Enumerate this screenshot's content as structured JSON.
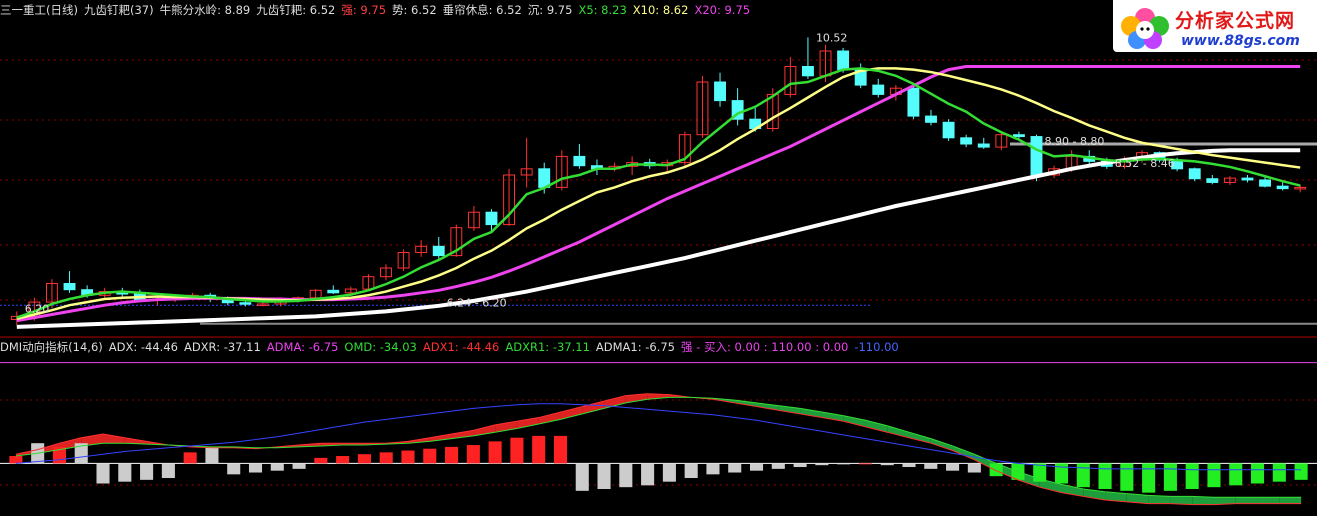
{
  "header_top": [
    {
      "text": "三一重工(日线)",
      "color": "#dddddd"
    },
    {
      "text": "九齿钉耙(37)",
      "color": "#dddddd"
    },
    {
      "text": "牛熊分水岭: 8.89",
      "color": "#dddddd"
    },
    {
      "text": "九齿钉耙: 6.52",
      "color": "#dddddd"
    },
    {
      "text": "强: 9.75",
      "color": "#ff4040"
    },
    {
      "text": "势: 6.52",
      "color": "#dddddd"
    },
    {
      "text": "垂帘休息: 6.52",
      "color": "#dddddd"
    },
    {
      "text": "沉: 9.75",
      "color": "#dddddd"
    },
    {
      "text": "X5: 8.23",
      "color": "#33dd33"
    },
    {
      "text": "X10: 8.62",
      "color": "#ffff88"
    },
    {
      "text": "X20: 9.75",
      "color": "#ee44ee"
    }
  ],
  "header_bottom": [
    {
      "text": "DMI动向指标(14,6)",
      "color": "#dddddd"
    },
    {
      "text": "ADX: -44.46",
      "color": "#dddddd"
    },
    {
      "text": "ADXR: -37.11",
      "color": "#dddddd"
    },
    {
      "text": "ADMA: -6.75",
      "color": "#ee44ee"
    },
    {
      "text": "OMD: -34.03",
      "color": "#33dd33"
    },
    {
      "text": "ADX1: -44.46",
      "color": "#ff3030"
    },
    {
      "text": "ADXR1: -37.11",
      "color": "#33dd33"
    },
    {
      "text": "ADMA1: -6.75",
      "color": "#dddddd"
    },
    {
      "text": "强 - 买入: 0.00 : 110.00 : 0.00",
      "color": "#ee44ee"
    },
    {
      "text": "-110.00",
      "color": "#4466ff"
    }
  ],
  "logo": {
    "text": "分析家公式网",
    "url": "www.88gs.com"
  },
  "colors": {
    "up": "#ff3333",
    "down": "#54fcfc",
    "x5": "#33dd33",
    "x10": "#ffff88",
    "x20": "#ee44ee",
    "long_ma": "#ffffff",
    "adx_line": "#3344ff",
    "grid": "#8b0000"
  },
  "chart_data": [
    {
      "type": "candlestick",
      "annotations": [
        "10.52",
        "8.90 - 8.80",
        "6.24 - 6.20",
        "6.20",
        "8.52 - 8.46"
      ],
      "ohlc": [
        [
          5.97,
          6.1,
          5.88,
          6.02
        ],
        [
          6.02,
          6.32,
          5.95,
          6.25
        ],
        [
          6.25,
          6.62,
          6.15,
          6.55
        ],
        [
          6.55,
          6.75,
          6.4,
          6.45
        ],
        [
          6.45,
          6.52,
          6.32,
          6.36
        ],
        [
          6.36,
          6.48,
          6.3,
          6.42
        ],
        [
          6.42,
          6.48,
          6.33,
          6.38
        ],
        [
          6.38,
          6.45,
          6.25,
          6.28
        ],
        [
          6.28,
          6.35,
          6.2,
          6.3
        ],
        [
          6.3,
          6.38,
          6.25,
          6.34
        ],
        [
          6.34,
          6.4,
          6.28,
          6.36
        ],
        [
          6.36,
          6.4,
          6.25,
          6.3
        ],
        [
          6.3,
          6.34,
          6.2,
          6.24
        ],
        [
          6.24,
          6.28,
          6.18,
          6.22
        ],
        [
          6.22,
          6.26,
          6.18,
          6.22
        ],
        [
          6.22,
          6.3,
          6.18,
          6.27
        ],
        [
          6.27,
          6.34,
          6.24,
          6.32
        ],
        [
          6.32,
          6.46,
          6.3,
          6.44
        ],
        [
          6.44,
          6.52,
          6.38,
          6.4
        ],
        [
          6.4,
          6.5,
          6.36,
          6.46
        ],
        [
          6.46,
          6.7,
          6.44,
          6.66
        ],
        [
          6.66,
          6.86,
          6.6,
          6.8
        ],
        [
          6.8,
          7.1,
          6.75,
          7.05
        ],
        [
          7.05,
          7.25,
          6.98,
          7.15
        ],
        [
          7.15,
          7.3,
          6.95,
          7.0
        ],
        [
          7.0,
          7.5,
          6.98,
          7.45
        ],
        [
          7.45,
          7.8,
          7.4,
          7.7
        ],
        [
          7.7,
          7.75,
          7.4,
          7.5
        ],
        [
          7.5,
          8.4,
          7.48,
          8.3
        ],
        [
          8.3,
          8.9,
          8.1,
          8.4
        ],
        [
          8.4,
          8.5,
          8.0,
          8.1
        ],
        [
          8.1,
          8.7,
          8.05,
          8.6
        ],
        [
          8.6,
          8.8,
          8.4,
          8.45
        ],
        [
          8.45,
          8.55,
          8.3,
          8.4
        ],
        [
          8.4,
          8.5,
          8.36,
          8.44
        ],
        [
          8.44,
          8.6,
          8.3,
          8.5
        ],
        [
          8.5,
          8.56,
          8.4,
          8.45
        ],
        [
          8.45,
          8.55,
          8.35,
          8.5
        ],
        [
          8.5,
          9.0,
          8.45,
          8.95
        ],
        [
          8.95,
          9.9,
          8.9,
          9.8
        ],
        [
          9.8,
          9.95,
          9.4,
          9.5
        ],
        [
          9.5,
          9.7,
          9.1,
          9.2
        ],
        [
          9.2,
          9.4,
          9.0,
          9.05
        ],
        [
          9.05,
          9.7,
          9.0,
          9.6
        ],
        [
          9.6,
          10.2,
          9.55,
          10.05
        ],
        [
          10.05,
          10.52,
          9.85,
          9.9
        ],
        [
          9.9,
          10.4,
          9.8,
          10.3
        ],
        [
          10.3,
          10.35,
          9.95,
          10.0
        ],
        [
          10.0,
          10.1,
          9.7,
          9.75
        ],
        [
          9.75,
          9.85,
          9.55,
          9.6
        ],
        [
          9.6,
          9.75,
          9.5,
          9.7
        ],
        [
          9.7,
          9.75,
          9.2,
          9.25
        ],
        [
          9.25,
          9.35,
          9.1,
          9.15
        ],
        [
          9.15,
          9.2,
          8.85,
          8.9
        ],
        [
          8.9,
          8.95,
          8.75,
          8.8
        ],
        [
          8.8,
          8.9,
          8.72,
          8.75
        ],
        [
          8.75,
          8.98,
          8.7,
          8.95
        ],
        [
          8.95,
          9.0,
          8.85,
          8.92
        ],
        [
          8.92,
          8.95,
          8.2,
          8.3
        ],
        [
          8.3,
          8.45,
          8.25,
          8.4
        ],
        [
          8.4,
          8.7,
          8.35,
          8.6
        ],
        [
          8.6,
          8.7,
          8.45,
          8.52
        ],
        [
          8.52,
          8.58,
          8.4,
          8.44
        ],
        [
          8.44,
          8.6,
          8.4,
          8.55
        ],
        [
          8.55,
          8.7,
          8.5,
          8.66
        ],
        [
          8.66,
          8.68,
          8.5,
          8.54
        ],
        [
          8.54,
          8.58,
          8.36,
          8.4
        ],
        [
          8.4,
          8.42,
          8.2,
          8.24
        ],
        [
          8.24,
          8.3,
          8.15,
          8.18
        ],
        [
          8.18,
          8.28,
          8.14,
          8.25
        ],
        [
          8.25,
          8.3,
          8.18,
          8.22
        ],
        [
          8.22,
          8.26,
          8.1,
          8.12
        ],
        [
          8.12,
          8.18,
          8.05,
          8.08
        ],
        [
          8.08,
          8.14,
          8.02,
          8.1
        ]
      ],
      "x5": [
        6.0,
        6.1,
        6.22,
        6.3,
        6.36,
        6.4,
        6.42,
        6.4,
        6.38,
        6.36,
        6.34,
        6.33,
        6.3,
        6.28,
        6.26,
        6.26,
        6.27,
        6.3,
        6.33,
        6.37,
        6.44,
        6.54,
        6.66,
        6.81,
        6.93,
        7.08,
        7.27,
        7.38,
        7.66,
        7.99,
        8.09,
        8.24,
        8.3,
        8.4,
        8.4,
        8.47,
        8.47,
        8.46,
        8.56,
        8.83,
        9.06,
        9.29,
        9.4,
        9.57,
        9.77,
        9.8,
        9.9,
        10.0,
        10.02,
        9.98,
        9.9,
        9.77,
        9.61,
        9.45,
        9.32,
        9.13,
        8.99,
        8.87,
        8.71,
        8.6,
        8.62,
        8.58,
        8.54,
        8.52,
        8.55,
        8.56,
        8.54,
        8.52,
        8.48,
        8.43,
        8.36,
        8.28,
        8.2,
        8.13
      ],
      "x10": [
        5.98,
        6.05,
        6.12,
        6.2,
        6.25,
        6.3,
        6.32,
        6.33,
        6.34,
        6.33,
        6.33,
        6.32,
        6.31,
        6.3,
        6.29,
        6.28,
        6.28,
        6.29,
        6.3,
        6.32,
        6.36,
        6.42,
        6.5,
        6.58,
        6.68,
        6.8,
        6.95,
        7.08,
        7.25,
        7.44,
        7.58,
        7.74,
        7.88,
        8.02,
        8.1,
        8.2,
        8.28,
        8.34,
        8.43,
        8.55,
        8.7,
        8.88,
        9.04,
        9.22,
        9.38,
        9.55,
        9.72,
        9.88,
        9.98,
        10.02,
        10.02,
        10.0,
        9.96,
        9.9,
        9.83,
        9.76,
        9.68,
        9.58,
        9.46,
        9.33,
        9.22,
        9.1,
        9.0,
        8.9,
        8.82,
        8.77,
        8.72,
        8.67,
        8.62,
        8.58,
        8.54,
        8.5,
        8.46,
        8.42
      ],
      "x20": [
        5.95,
        6.0,
        6.05,
        6.1,
        6.15,
        6.2,
        6.24,
        6.27,
        6.29,
        6.3,
        6.31,
        6.31,
        6.31,
        6.31,
        6.3,
        6.3,
        6.29,
        6.29,
        6.29,
        6.3,
        6.31,
        6.33,
        6.36,
        6.4,
        6.44,
        6.5,
        6.57,
        6.65,
        6.75,
        6.86,
        6.98,
        7.1,
        7.22,
        7.36,
        7.5,
        7.64,
        7.78,
        7.92,
        8.04,
        8.16,
        8.28,
        8.4,
        8.52,
        8.64,
        8.76,
        8.9,
        9.04,
        9.18,
        9.32,
        9.46,
        9.6,
        9.74,
        9.88,
        10.0,
        10.05,
        10.05,
        10.05,
        10.05,
        10.05,
        10.05,
        10.05,
        10.05,
        10.05,
        10.05,
        10.05,
        10.05,
        10.05,
        10.05,
        10.05,
        10.05,
        10.05,
        10.05,
        10.05,
        10.05
      ],
      "long_ma": [
        5.85,
        5.86,
        5.87,
        5.88,
        5.89,
        5.9,
        5.91,
        5.92,
        5.93,
        5.94,
        5.95,
        5.96,
        5.97,
        5.98,
        5.99,
        6.0,
        6.01,
        6.02,
        6.04,
        6.06,
        6.08,
        6.1,
        6.13,
        6.16,
        6.19,
        6.23,
        6.27,
        6.32,
        6.37,
        6.42,
        6.48,
        6.54,
        6.6,
        6.66,
        6.72,
        6.78,
        6.84,
        6.9,
        6.96,
        7.03,
        7.1,
        7.17,
        7.24,
        7.31,
        7.38,
        7.45,
        7.52,
        7.59,
        7.66,
        7.73,
        7.8,
        7.86,
        7.92,
        7.98,
        8.04,
        8.1,
        8.16,
        8.22,
        8.28,
        8.34,
        8.4,
        8.45,
        8.5,
        8.54,
        8.58,
        8.62,
        8.65,
        8.67,
        8.69,
        8.7,
        8.7,
        8.7,
        8.7,
        8.7
      ],
      "ylim": [
        5.8,
        10.8
      ]
    },
    {
      "type": "area",
      "series": [
        {
          "name": "ADX1",
          "values": [
            10,
            15,
            22,
            28,
            32,
            28,
            24,
            20,
            18,
            17,
            17,
            16,
            18,
            20,
            22,
            22,
            22,
            22,
            24,
            28,
            32,
            36,
            42,
            46,
            50,
            56,
            62,
            68,
            74,
            76,
            75,
            72,
            70,
            66,
            62,
            58,
            54,
            50,
            46,
            40,
            34,
            28,
            22,
            14,
            4,
            -8,
            -18,
            -26,
            -32,
            -36,
            -40,
            -42,
            -44,
            -44,
            -45,
            -45,
            -44,
            -44,
            -44,
            -44
          ]
        },
        {
          "name": "ADXR1",
          "values": [
            8,
            11,
            15,
            19,
            22,
            22,
            21,
            20,
            19,
            18,
            18,
            17,
            17,
            18,
            19,
            20,
            20,
            21,
            22,
            24,
            27,
            30,
            34,
            38,
            43,
            48,
            54,
            60,
            66,
            70,
            72,
            72,
            71,
            69,
            66,
            63,
            60,
            56,
            52,
            47,
            41,
            34,
            27,
            19,
            10,
            0,
            -9,
            -17,
            -23,
            -28,
            -31,
            -33,
            -35,
            -36,
            -36,
            -37,
            -37,
            -37,
            -37,
            -37
          ]
        },
        {
          "name": "ADMA1",
          "values": [
            0,
            2,
            4,
            7,
            10,
            13,
            15,
            17,
            19,
            21,
            23,
            26,
            29,
            33,
            37,
            41,
            45,
            48,
            51,
            54,
            57,
            60,
            62,
            64,
            65,
            65,
            64,
            63,
            61,
            59,
            57,
            55,
            53,
            50,
            47,
            43,
            39,
            35,
            31,
            27,
            23,
            19,
            15,
            11,
            7,
            3,
            0,
            -2,
            -4,
            -5,
            -6,
            -6,
            -6,
            -6,
            -7,
            -7,
            -7,
            -7,
            -7,
            -7
          ]
        }
      ],
      "bars": [
        8,
        22,
        18,
        22,
        -22,
        -20,
        -18,
        -16,
        12,
        18,
        -12,
        -10,
        -8,
        -6,
        6,
        8,
        10,
        12,
        14,
        16,
        18,
        20,
        24,
        28,
        30,
        30,
        -30,
        -28,
        -26,
        -24,
        -20,
        -16,
        -12,
        -10,
        -8,
        -6,
        -4,
        -2,
        -1,
        0,
        -2,
        -4,
        -6,
        -8,
        -10,
        -14,
        -18,
        -20,
        -22,
        -26,
        -28,
        -30,
        -32,
        -30,
        -28,
        -26,
        -24,
        -22,
        -20,
        -18
      ],
      "hlines": [
        110,
        0
      ],
      "ylim": [
        -40,
        115
      ]
    }
  ]
}
